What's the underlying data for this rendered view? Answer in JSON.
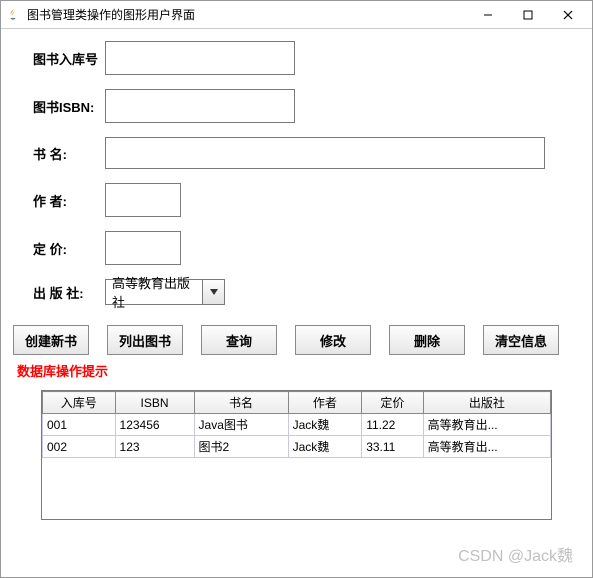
{
  "window": {
    "title": "图书管理类操作的图形用户界面"
  },
  "form": {
    "label_id": "图书入库号",
    "label_isbn": "图书ISBN:",
    "label_name": "书 名:",
    "label_author": "作 者:",
    "label_price": "定 价:",
    "label_publisher": "出 版 社:",
    "value_id": "",
    "value_isbn": "",
    "value_name": "",
    "value_author": "",
    "value_price": "",
    "publisher_selected": "高等教育出版社"
  },
  "buttons": {
    "create": "创建新书",
    "list": "列出图书",
    "query": "查询",
    "modify": "修改",
    "delete": "删除",
    "clear": "清空信息"
  },
  "status": "数据库操作提示",
  "table": {
    "headers": [
      "入库号",
      "ISBN",
      "书名",
      "作者",
      "定价",
      "出版社"
    ],
    "rows": [
      [
        "001",
        "123456",
        "Java图书",
        "Jack魏",
        "11.22",
        "高等教育出..."
      ],
      [
        "002",
        "123",
        "图书2",
        "Jack魏",
        "33.11",
        "高等教育出..."
      ]
    ]
  },
  "watermark": "CSDN @Jack魏"
}
